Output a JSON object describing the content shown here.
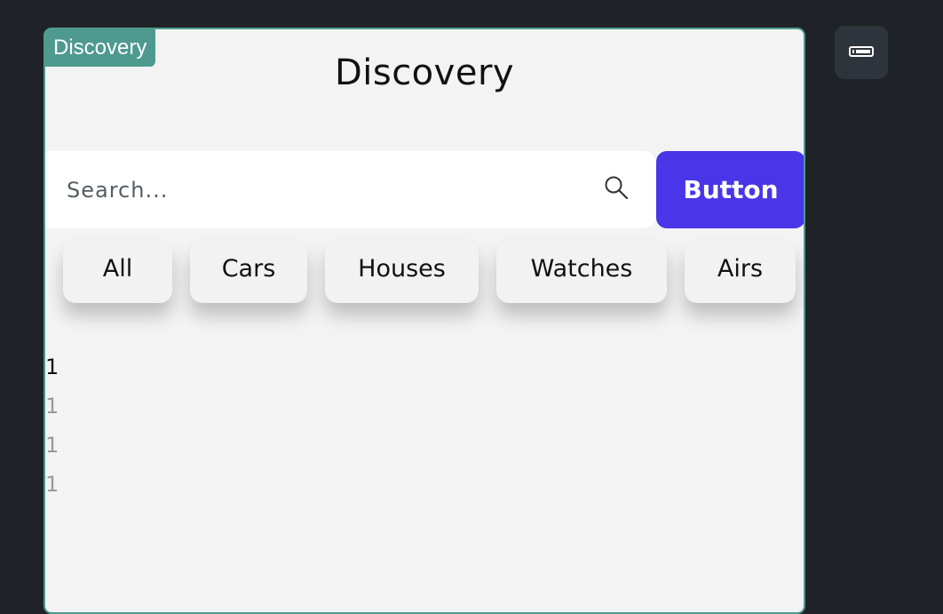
{
  "frame": {
    "tag_label": "Discovery",
    "accent_color": "#4e9a8e"
  },
  "header": {
    "title": "Discovery"
  },
  "search": {
    "placeholder": "Search...",
    "value": "",
    "icon": "search-icon"
  },
  "action_button": {
    "label": "Button",
    "color": "#4a35e8"
  },
  "categories": [
    {
      "label": "All"
    },
    {
      "label": "Cars"
    },
    {
      "label": "Houses"
    },
    {
      "label": "Watches"
    },
    {
      "label": "Airs"
    }
  ],
  "list": {
    "items": [
      "1",
      "1",
      "1",
      "1"
    ]
  },
  "side_toolbar": {
    "icon": "device-preview-icon"
  }
}
